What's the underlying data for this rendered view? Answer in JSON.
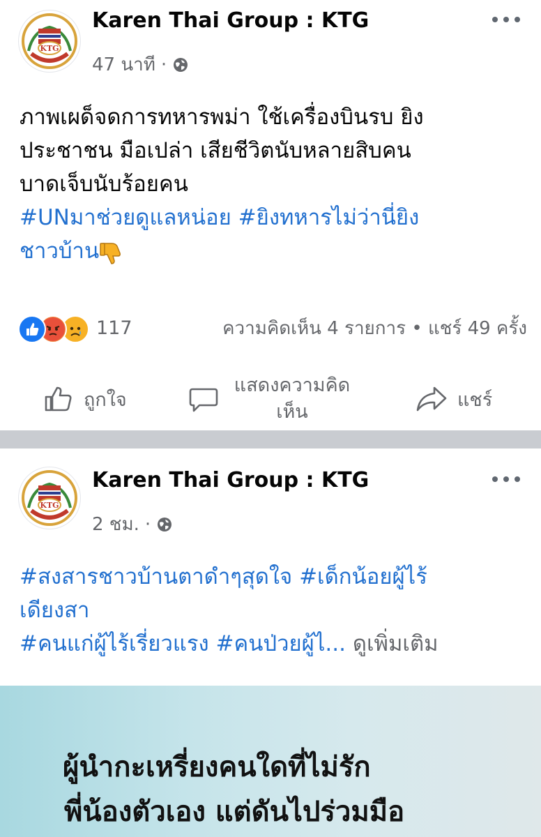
{
  "posts": [
    {
      "page_name": "Karen Thai Group : KTG",
      "time": "47 นาที",
      "body_lines": [
        "ภาพเผด็จดการทหารพม่า ใช้เครื่องบินรบ ยิง",
        "ประชาชน มือเปล่า เสียชีวิตนับหลายสิบคน",
        "บาดเจ็บนับร้อยคน"
      ],
      "hashtags_line1": "#UNมาช่วยดูแลหน่อย  #ยิงทหารไม่ว่านี่ยิง",
      "hashtags_line2": "ชาวบ้าน",
      "reaction_count": "117",
      "stats": "ความคิดเห็น 4 รายการ • แชร์ 49 ครั้ง",
      "actions": {
        "like": "ถูกใจ",
        "comment": "แสดงความคิดเห็น",
        "share": "แชร์"
      }
    },
    {
      "page_name": "Karen Thai Group : KTG",
      "time": "2 ชม.",
      "hashtag_line1": "#สงสารชาวบ้านตาดำๆสุดใจ #เด็กน้อยผู้ไร้",
      "hashtag_line2": "เดียงสา",
      "hashtag_line3": "#คนแก่ผู้ไร้เรี่ยวแรง #คนป่วยผู้ไ...",
      "see_more": "ดูเพิ่มเติม",
      "image_text": [
        "ผู้นำกะเหรี่ยงคนใดที่ไม่รัก",
        "พี่น้องตัวเอง แต่ดันไปร่วมมือ"
      ]
    }
  ],
  "colors": {
    "hashtag": "#2270cf",
    "secondary_text": "#65676b",
    "divider": "#c9ccd1",
    "like_blue": "#1877f2"
  },
  "icons": [
    "ktg-logo-avatar",
    "globe-icon",
    "more-options-icon",
    "thumbs-down-emoji",
    "like-reaction-icon",
    "angry-reaction-icon",
    "sad-reaction-icon",
    "like-icon",
    "comment-icon",
    "share-icon"
  ]
}
